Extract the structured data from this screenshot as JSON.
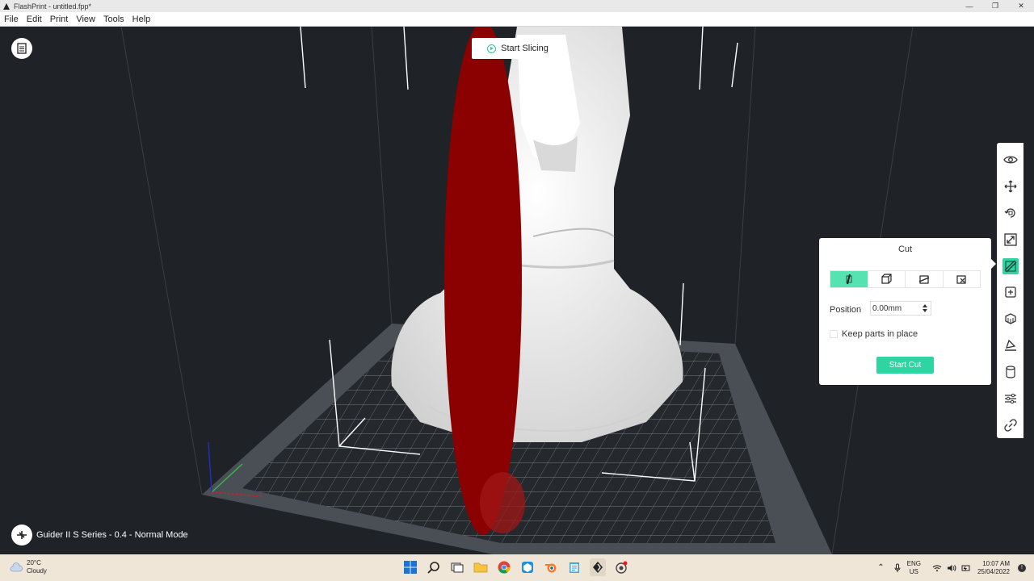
{
  "window": {
    "title": "FlashPrint - untitled.fpp*",
    "controls": [
      "minimize",
      "restore",
      "close"
    ]
  },
  "menu": [
    "File",
    "Edit",
    "Print",
    "View",
    "Tools",
    "Help"
  ],
  "viewport": {
    "slice_label": "Start Slicing",
    "machine_status": "Guider II S Series - 0.4 - Normal Mode"
  },
  "toolbar": {
    "tools": [
      {
        "icon": "eye-icon"
      },
      {
        "icon": "move-icon"
      },
      {
        "icon": "rotate-icon"
      },
      {
        "icon": "scale-icon"
      },
      {
        "icon": "cut-icon",
        "active": true
      },
      {
        "icon": "add-part-icon"
      },
      {
        "icon": "supports-icon"
      },
      {
        "icon": "lay-flat-icon"
      },
      {
        "icon": "cylinder-icon"
      },
      {
        "icon": "settings-sliders-icon"
      },
      {
        "icon": "link-icon"
      }
    ]
  },
  "cut_panel": {
    "title": "Cut",
    "modes": [
      "cut-vertical-icon",
      "cut-cube-icon",
      "cut-diagonal-icon",
      "cut-custom-icon"
    ],
    "active_mode": 0,
    "position_label": "Position",
    "position_value": "0.00mm",
    "keep_parts_label": "Keep parts in place",
    "keep_parts_checked": false,
    "start_cut_label": "Start Cut"
  },
  "taskbar": {
    "temperature": "20°C",
    "weather": "Cloudy",
    "lang_1": "ENG",
    "lang_2": "US",
    "time": "10:07 AM",
    "date": "25/04/2022"
  },
  "colors": {
    "accent": "#2fd5a0",
    "cut_plane": "#8b0000",
    "model": "#f2f2f2",
    "viewport_bg": "#1f2227"
  }
}
